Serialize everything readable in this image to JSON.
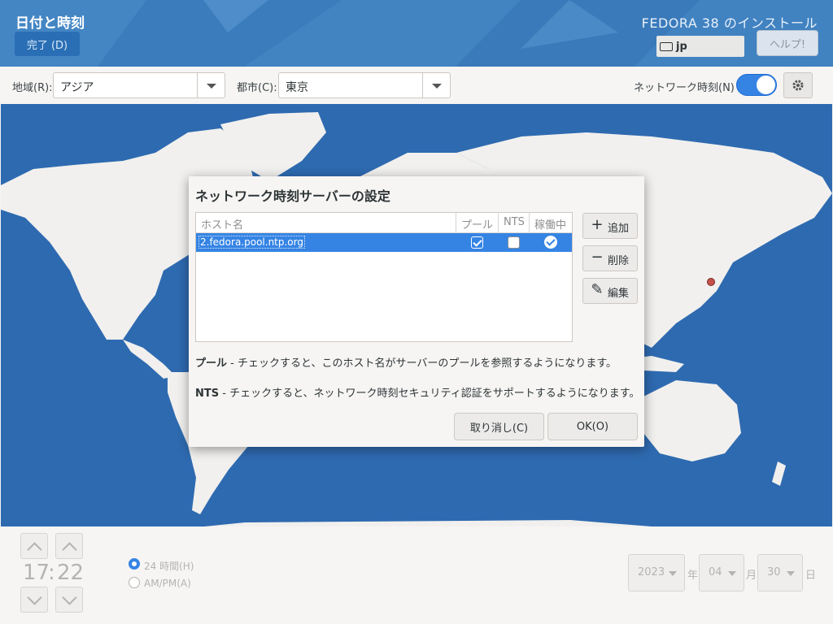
{
  "header": {
    "spoke_title": "日付と時刻",
    "done_button": "完了 (D)",
    "product_title": "FEDORA 38 のインストール",
    "keyboard_layout": "jp",
    "help_button": "ヘルプ!"
  },
  "toolbar": {
    "region_label": "地域(R):",
    "region_value": "アジア",
    "city_label": "都市(C):",
    "city_value": "東京",
    "network_time_label": "ネットワーク時刻(N)",
    "network_time_enabled": true
  },
  "map": {
    "selected_city_marker": "東京",
    "colors": {
      "ocean": "#2e6ab0",
      "land": "#f1f0ee",
      "marker": "#c5504a"
    }
  },
  "time": {
    "hours": "17",
    "separator": ":",
    "minutes": "22",
    "format_24h": "24 時間(H)",
    "format_ampm": "AM/PM(A)",
    "selected_format": "24h"
  },
  "date": {
    "year": "2023",
    "year_suffix": "年",
    "month": "04",
    "month_suffix": "月",
    "day": "30",
    "day_suffix": "日"
  },
  "dialog": {
    "title": "ネットワーク時刻サーバーの設定",
    "columns": [
      "ホスト名",
      "プール",
      "NTS",
      "稼働中"
    ],
    "rows": [
      {
        "host": "2.fedora.pool.ntp.org",
        "pool": true,
        "nts": false,
        "working": true
      }
    ],
    "add_button": "追加",
    "remove_button": "削除",
    "edit_button": "編集",
    "pool_term": "プール",
    "pool_desc": " - チェックすると、このホスト名がサーバーのプールを参照するようになります。",
    "nts_term": "NTS",
    "nts_desc": " - チェックすると、ネットワーク時刻セキュリティ認証をサポートするようになります。",
    "cancel_button": "取り消し(C)",
    "ok_button": "OK(O)"
  }
}
